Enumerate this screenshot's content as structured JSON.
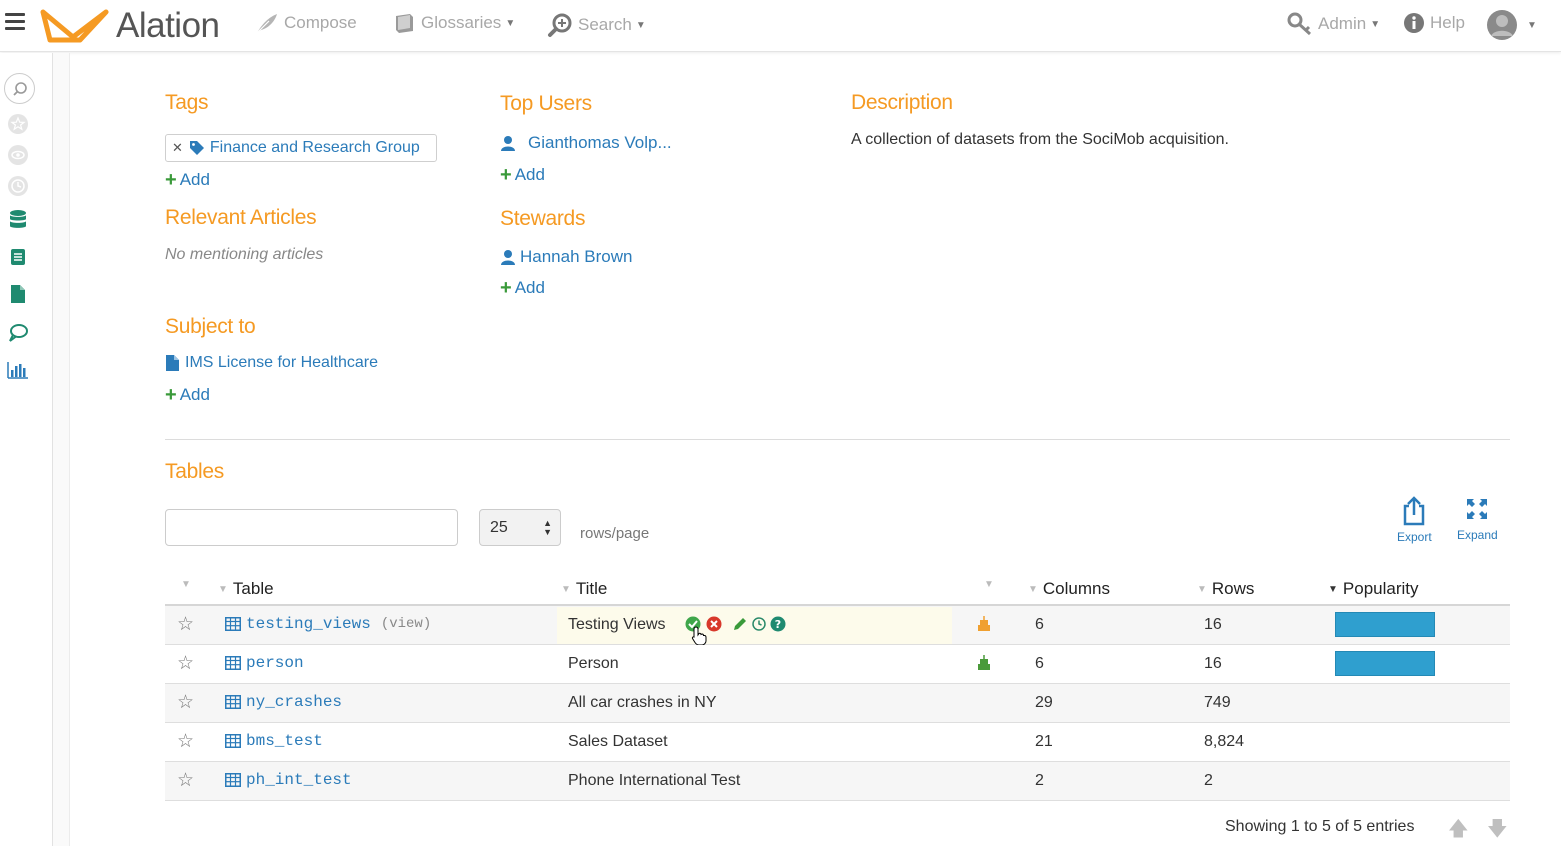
{
  "header": {
    "app_name": "Alation",
    "nav": {
      "compose": "Compose",
      "glossaries": "Glossaries",
      "search": "Search",
      "admin": "Admin",
      "help": "Help"
    },
    "colors": {
      "brand": "#f59a23",
      "link": "#2b7bb9"
    }
  },
  "left_rail": {
    "icons": [
      "search-icon",
      "star-icon",
      "eye-icon",
      "clock-icon",
      "database-icon",
      "table-icon",
      "document-icon",
      "comment-icon",
      "chart-icon"
    ]
  },
  "tags": {
    "title": "Tags",
    "items": [
      "Finance and Research Group"
    ],
    "add_label": "Add"
  },
  "relevant_articles": {
    "title": "Relevant Articles",
    "empty_text": "No mentioning articles"
  },
  "subject_to": {
    "title": "Subject to",
    "items": [
      "IMS License for Healthcare"
    ],
    "add_label": "Add"
  },
  "top_users": {
    "title": "Top Users",
    "items": [
      "Gianthomas Volp..."
    ],
    "add_label": "Add"
  },
  "stewards": {
    "title": "Stewards",
    "items": [
      "Hannah Brown"
    ],
    "add_label": "Add"
  },
  "description": {
    "title": "Description",
    "text": "A collection of datasets from the SociMob acquisition."
  },
  "tables": {
    "title": "Tables",
    "search_value": "",
    "page_size": "25",
    "rows_label": "rows/page",
    "export_label": "Export",
    "expand_label": "Expand",
    "columns": [
      "Table",
      "Title",
      "Columns",
      "Rows",
      "Popularity"
    ],
    "rows": [
      {
        "name": "testing_views",
        "tag": "(view)",
        "title": "Testing Views",
        "columns": "6",
        "rows": "16",
        "popularity": 1.0,
        "robot": "orange"
      },
      {
        "name": "person",
        "tag": "",
        "title": "Person",
        "columns": "6",
        "rows": "16",
        "popularity": 1.0,
        "robot": "green"
      },
      {
        "name": "ny_crashes",
        "tag": "",
        "title": "All car crashes in NY",
        "columns": "29",
        "rows": "749",
        "popularity": 0,
        "robot": ""
      },
      {
        "name": "bms_test",
        "tag": "",
        "title": "Sales Dataset",
        "columns": "21",
        "rows": "8,824",
        "popularity": 0,
        "robot": ""
      },
      {
        "name": "ph_int_test",
        "tag": "",
        "title": "Phone International Test",
        "columns": "2",
        "rows": "2",
        "popularity": 0,
        "robot": ""
      }
    ],
    "footer": "Showing 1 to 5 of 5 entries"
  }
}
